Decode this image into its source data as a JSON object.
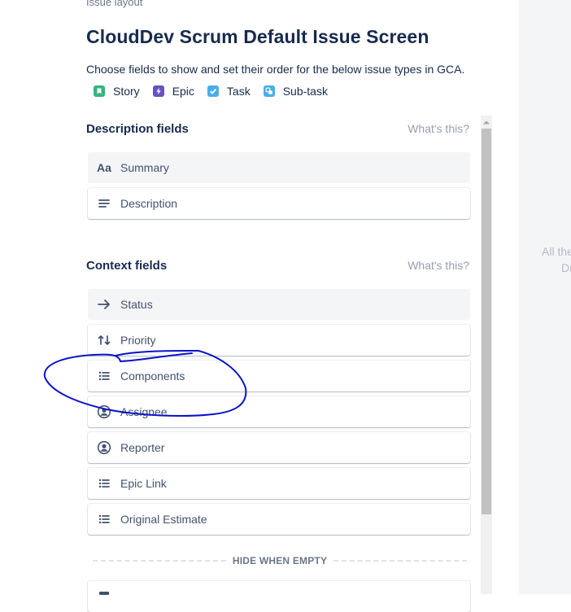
{
  "breadcrumb": "Issue layout",
  "title": "CloudDev Scrum Default Issue Screen",
  "subtitle": "Choose fields to show and set their order for the below issue types in GCA.",
  "issue_types": [
    {
      "label": "Story",
      "icon": "story-icon",
      "color": "#36B37E"
    },
    {
      "label": "Epic",
      "icon": "epic-icon",
      "color": "#6554C0"
    },
    {
      "label": "Task",
      "icon": "task-icon",
      "color": "#4BADE8"
    },
    {
      "label": "Sub-task",
      "icon": "subtask-icon",
      "color": "#4BADE8"
    }
  ],
  "description_section": {
    "title": "Description fields",
    "help": "What's this?",
    "fields": [
      {
        "label": "Summary",
        "icon": "text-icon"
      },
      {
        "label": "Description",
        "icon": "align-left-icon"
      }
    ]
  },
  "context_section": {
    "title": "Context fields",
    "help": "What's this?",
    "fields": [
      {
        "label": "Status",
        "icon": "arrow-right-icon"
      },
      {
        "label": "Priority",
        "icon": "sort-icon"
      },
      {
        "label": "Components",
        "icon": "list-icon"
      },
      {
        "label": "Assignee",
        "icon": "person-icon"
      },
      {
        "label": "Reporter",
        "icon": "person-icon"
      },
      {
        "label": "Epic Link",
        "icon": "list-icon"
      },
      {
        "label": "Original Estimate",
        "icon": "list-icon"
      }
    ],
    "hide_when_empty": "HIDE WHEN EMPTY"
  },
  "right_panel": {
    "line1": "All the",
    "line2": "Dr"
  }
}
